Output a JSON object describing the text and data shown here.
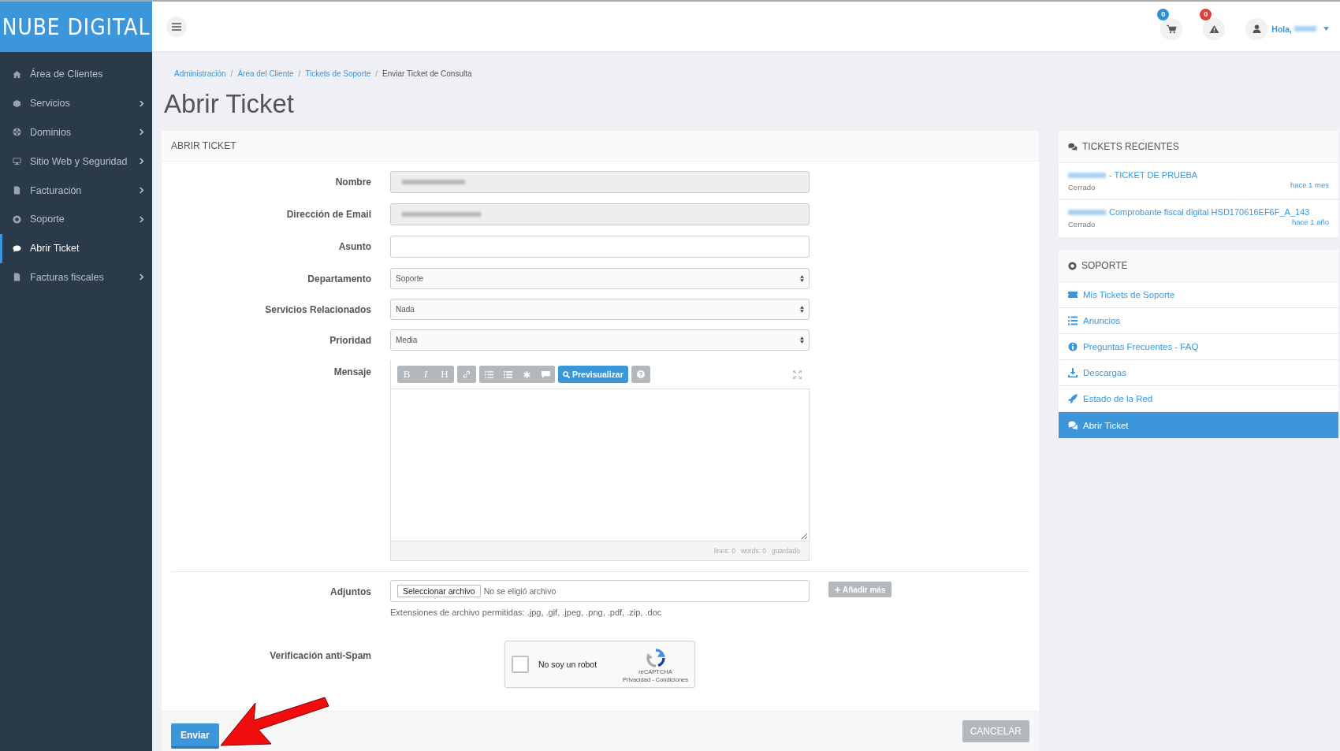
{
  "brand": "NUBE DIGITAL",
  "sidebar": {
    "items": [
      {
        "label": "Área de Clientes",
        "expandable": false,
        "selected": false
      },
      {
        "label": "Servicios",
        "expandable": true,
        "selected": false
      },
      {
        "label": "Dominios",
        "expandable": true,
        "selected": false
      },
      {
        "label": "Sitio Web y Seguridad",
        "expandable": true,
        "selected": false
      },
      {
        "label": "Facturación",
        "expandable": true,
        "selected": false
      },
      {
        "label": "Soporte",
        "expandable": true,
        "selected": false
      },
      {
        "label": "Abrir Ticket",
        "expandable": false,
        "selected": true
      },
      {
        "label": "Facturas fiscales",
        "expandable": true,
        "selected": false
      }
    ]
  },
  "header": {
    "cart_count": "0",
    "alert_count": "0",
    "greeting": "Hola,"
  },
  "breadcrumb": {
    "separator": "/",
    "items": [
      {
        "label": "Administración",
        "current": false
      },
      {
        "label": "Área del Cliente",
        "current": false
      },
      {
        "label": "Tickets de Soporte",
        "current": false
      },
      {
        "label": "Enviar Ticket de Consulta",
        "current": true
      }
    ]
  },
  "page_title": "Abrir Ticket",
  "form": {
    "title": "ABRIR TICKET",
    "fields": [
      {
        "kind": "text",
        "label": "Nombre",
        "disabled": true
      },
      {
        "kind": "text",
        "label": "Dirección de Email",
        "disabled": true
      },
      {
        "kind": "text",
        "label": "Asunto",
        "disabled": false
      },
      {
        "kind": "select",
        "label": "Departamento",
        "value": "Soporte"
      },
      {
        "kind": "select",
        "label": "Servicios Relacionados",
        "value": "Nada"
      },
      {
        "kind": "select",
        "label": "Prioridad",
        "value": "Media"
      }
    ],
    "message": {
      "label": "Mensaje",
      "format_buttons": [
        "B",
        "I",
        "H"
      ],
      "preview_button": "Previsualizar",
      "status": [
        "lines: 0",
        "words: 0",
        "guardado"
      ]
    },
    "attachments": {
      "label": "Adjuntos",
      "file_button": "Seleccionar archivo",
      "file_status": "No se eligió archivo",
      "add_more": "Añadir más",
      "help": "Extensiones de archivo permitidas: .jpg, .gif, .jpeg, .png, .pdf, .zip, .doc"
    },
    "captcha": {
      "label": "Verificación anti-Spam",
      "checkbox_label": "No soy un robot",
      "checked": false,
      "brand": "reCAPTCHA",
      "terms": "Privacidad - Condiciones"
    },
    "submit": "Enviar",
    "cancel": "CANCELAR"
  },
  "recent_tickets": {
    "title": "TICKETS RECIENTES",
    "items": [
      {
        "subject": "- TICKET DE PRUEBA",
        "status": "Cerrado",
        "time": "hace 1 mes"
      },
      {
        "subject": "Comprobante fiscal digital HSD170616EF6F_A_143",
        "status": "Cerrado",
        "time": "hace 1 año"
      }
    ]
  },
  "support": {
    "title": "SOPORTE",
    "links": [
      {
        "label": "Mis Tickets de Soporte",
        "selected": false
      },
      {
        "label": "Anuncios",
        "selected": false
      },
      {
        "label": "Preguntas Frecuentes - FAQ",
        "selected": false
      },
      {
        "label": "Descargas",
        "selected": false
      },
      {
        "label": "Estado de la Red",
        "selected": false
      },
      {
        "label": "Abrir Ticket",
        "selected": true
      }
    ]
  }
}
